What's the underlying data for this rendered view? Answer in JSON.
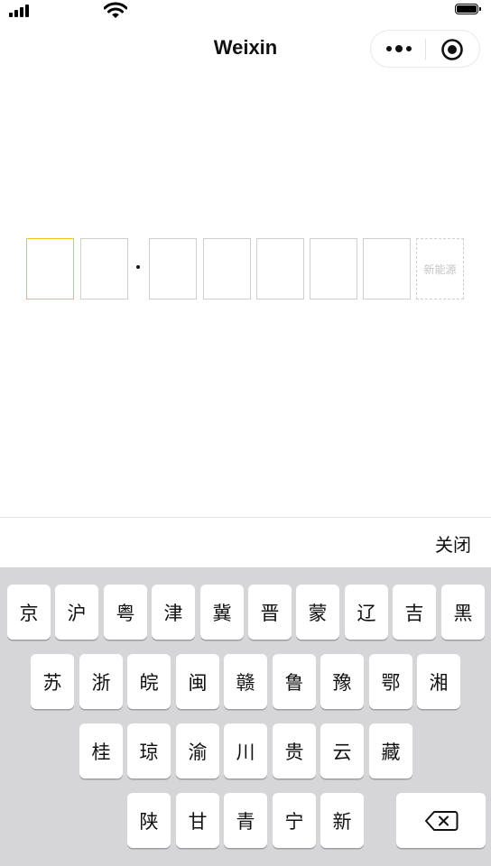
{
  "status_bar": {
    "signal_icon": "cellular-signal-icon",
    "wifi_icon": "wifi-icon",
    "battery_icon": "battery-full-icon"
  },
  "nav": {
    "title": "Weixin",
    "more_icon": "more-dots-icon",
    "close_icon": "target-circle-icon"
  },
  "plate_input": {
    "box_count": 8,
    "active_index": 0,
    "new_energy_label": "新能源",
    "active_color": "#f2c418"
  },
  "keyboard": {
    "close_label": "关闭",
    "row1": [
      "京",
      "沪",
      "粤",
      "津",
      "冀",
      "晋",
      "蒙",
      "辽",
      "吉",
      "黑"
    ],
    "row2": [
      "苏",
      "浙",
      "皖",
      "闽",
      "赣",
      "鲁",
      "豫",
      "鄂",
      "湘"
    ],
    "row3": [
      "桂",
      "琼",
      "渝",
      "川",
      "贵",
      "云",
      "藏"
    ],
    "row4": [
      "陕",
      "甘",
      "青",
      "宁",
      "新"
    ],
    "backspace_icon": "backspace-icon",
    "background": "#d6d6d9"
  }
}
